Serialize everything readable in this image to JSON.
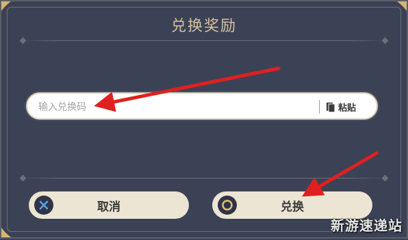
{
  "dialog": {
    "title": "兑换奖励"
  },
  "code_input": {
    "placeholder": "输入兑换码",
    "value": ""
  },
  "paste": {
    "label": "粘贴",
    "icon": "clipboard-icon"
  },
  "buttons": {
    "cancel_label": "取消",
    "cancel_icon": "x-circle-icon",
    "confirm_label": "兑换",
    "confirm_icon": "o-circle-icon"
  },
  "watermark": "新游速递站",
  "colors": {
    "background": "#3c4256",
    "title": "#d4c29e",
    "button_bg": "#ece5d3",
    "accent_blue": "#5aa4e8",
    "accent_gold": "#e0c66a",
    "arrow": "#e02020"
  }
}
